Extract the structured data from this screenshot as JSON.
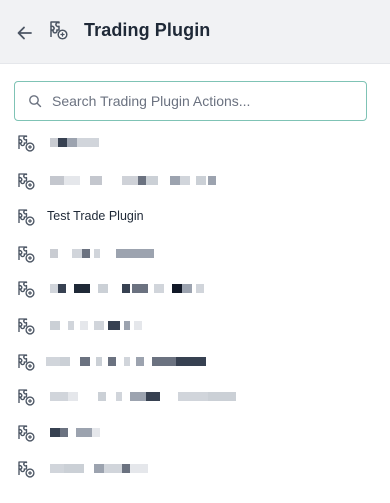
{
  "header": {
    "title": "Trading Plugin",
    "back_icon": "arrow-left-icon",
    "plugin_icon": "puzzle-plugin-icon"
  },
  "search": {
    "placeholder": "Search Trading Plugin Actions...",
    "value": "",
    "icon": "search-icon"
  },
  "actions": [
    {
      "label": "",
      "redacted": true
    },
    {
      "label": "",
      "redacted": true
    },
    {
      "label": "Test Trade Plugin",
      "redacted": false
    },
    {
      "label": "",
      "redacted": true
    },
    {
      "label": "",
      "redacted": true
    },
    {
      "label": "",
      "redacted": true
    },
    {
      "label": "",
      "redacted": true
    },
    {
      "label": "",
      "redacted": true
    },
    {
      "label": "",
      "redacted": true
    },
    {
      "label": "",
      "redacted": true
    }
  ],
  "colors": {
    "header_bg": "#f1f2f4",
    "search_border": "#7fc3b5",
    "text": "#1f2937",
    "icon": "#4b5563"
  }
}
